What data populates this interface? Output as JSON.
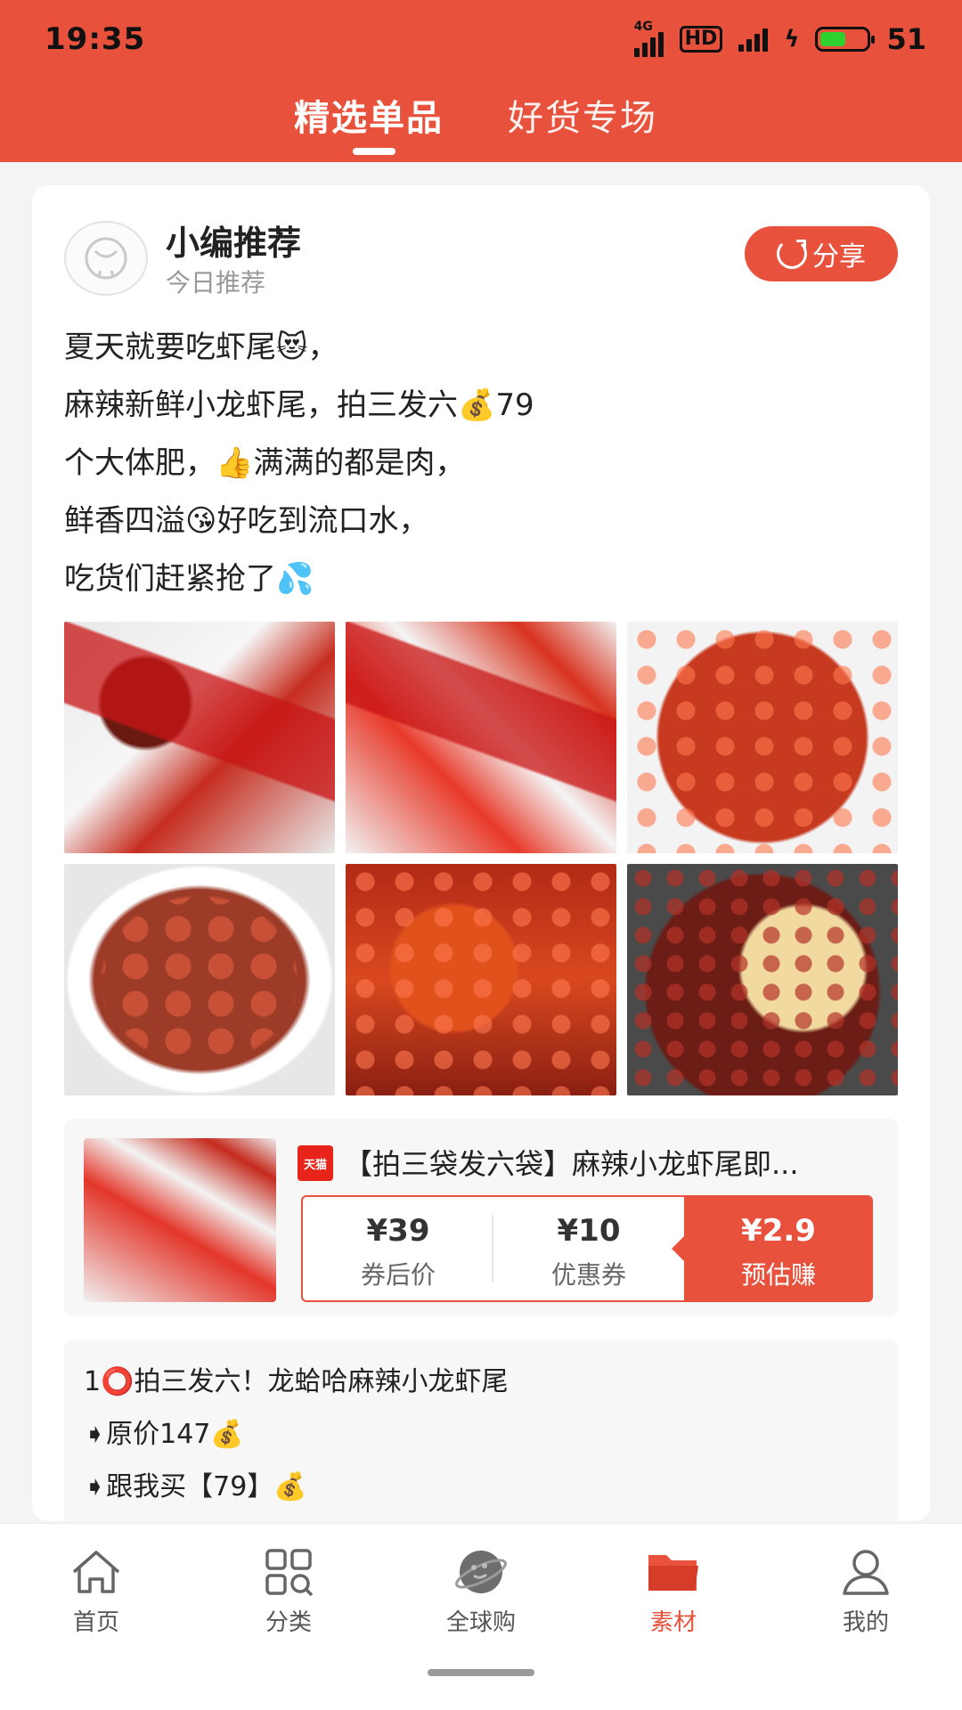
{
  "status_bar": {
    "time": "19:35",
    "network": "4G",
    "hd": "HD",
    "battery": "51"
  },
  "tabs": [
    {
      "label": "精选单品",
      "active": true
    },
    {
      "label": "好货专场",
      "active": false
    }
  ],
  "post": {
    "author": "小编推荐",
    "subtitle": "今日推荐",
    "share_label": "分享",
    "lines": [
      "夏天就要吃虾尾😻，",
      "麻辣新鲜小龙虾尾，拍三发六💰79",
      "个大体肥，👍满满的都是肉，",
      "鲜香四溢😘好吃到流口水，",
      "吃货们赶紧抢了💦"
    ]
  },
  "product": {
    "platform": "天猫",
    "title": "【拍三袋发六袋】麻辣小龙虾尾即...",
    "prices": [
      {
        "amount": "¥39",
        "label": "券后价"
      },
      {
        "amount": "¥10",
        "label": "优惠券"
      },
      {
        "amount": "¥2.9",
        "label": "预估赚"
      }
    ]
  },
  "copy_lines": [
    "1⭕拍三发六！龙蛤哈麻辣小龙虾尾",
    "➧原价147💰",
    "➧跟我买【79】💰"
  ],
  "bottom_nav": [
    {
      "label": "首页",
      "icon": "home-icon",
      "active": false
    },
    {
      "label": "分类",
      "icon": "category-icon",
      "active": false
    },
    {
      "label": "全球购",
      "icon": "planet-icon",
      "active": false
    },
    {
      "label": "素材",
      "icon": "folder-icon",
      "active": true
    },
    {
      "label": "我的",
      "icon": "user-icon",
      "active": false
    }
  ],
  "colors": {
    "brand": "#e8513c",
    "background": "#f4f4f4"
  }
}
